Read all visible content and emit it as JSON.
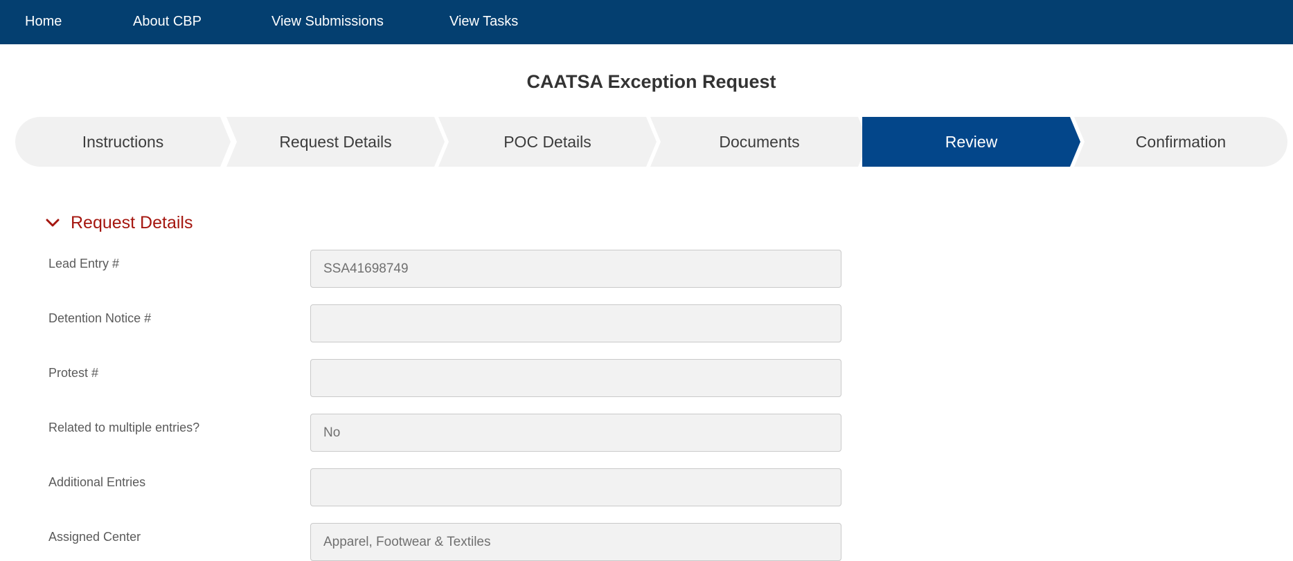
{
  "nav": {
    "items": [
      "Home",
      "About CBP",
      "View Submissions",
      "View Tasks"
    ]
  },
  "page": {
    "title": "CAATSA Exception Request"
  },
  "steps": {
    "items": [
      "Instructions",
      "Request Details",
      "POC Details",
      "Documents",
      "Review",
      "Confirmation"
    ],
    "active": "Review"
  },
  "section": {
    "title": "Request Details",
    "icon": "chevron-down-icon",
    "fields": [
      {
        "label": "Lead Entry #",
        "value": "SSA41698749"
      },
      {
        "label": "Detention Notice #",
        "value": ""
      },
      {
        "label": "Protest #",
        "value": ""
      },
      {
        "label": "Related to multiple entries?",
        "value": "No"
      },
      {
        "label": "Additional Entries",
        "value": ""
      },
      {
        "label": "Assigned Center",
        "value": "Apparel, Footwear & Textiles"
      }
    ]
  },
  "colors": {
    "nav_bg": "#043f70",
    "active_step": "#03468a",
    "step_bg": "#f1f1f1",
    "section_title": "#a5160f"
  }
}
